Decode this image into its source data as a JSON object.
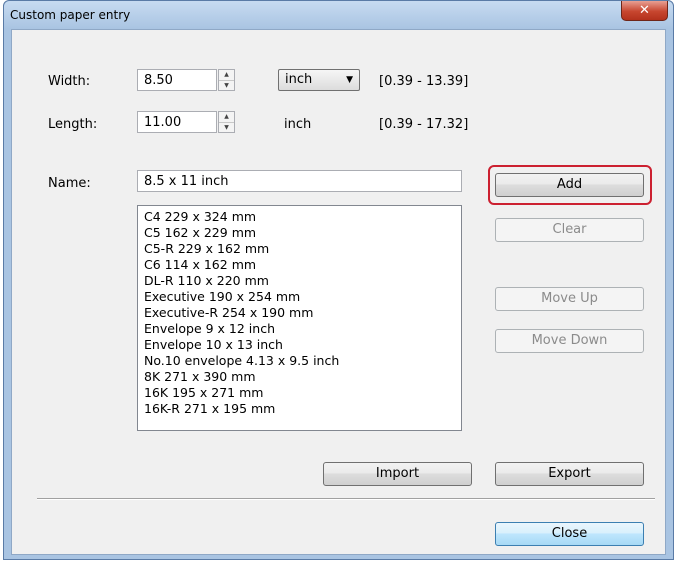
{
  "window": {
    "title": "Custom paper entry",
    "close_glyph": "✕"
  },
  "width": {
    "label": "Width:",
    "value": "8.50",
    "unit": "inch",
    "range": "[0.39 - 13.39]"
  },
  "length": {
    "label": "Length:",
    "value": "11.00",
    "unit": "inch",
    "range": "[0.39 - 17.32]"
  },
  "name": {
    "label": "Name:",
    "value": "8.5 x 11 inch"
  },
  "paper_list": [
    "C4 229 x 324 mm",
    "C5 162 x 229 mm",
    "C5-R 229 x 162 mm",
    "C6 114 x 162 mm",
    "DL-R 110 x 220 mm",
    "Executive 190 x 254 mm",
    "Executive-R 254 x 190 mm",
    "Envelope 9 x 12 inch",
    "Envelope 10 x 13 inch",
    "No.10 envelope 4.13 x 9.5 inch",
    "8K 271 x 390 mm",
    "16K 195 x 271 mm",
    "16K-R 271 x 195 mm"
  ],
  "buttons": {
    "add": "Add",
    "clear": "Clear",
    "move_up": "Move Up",
    "move_down": "Move Down",
    "import": "Import",
    "export": "Export",
    "close": "Close"
  },
  "colors": {
    "highlight": "#cc2030",
    "titlebar": "#a9c4e2"
  }
}
